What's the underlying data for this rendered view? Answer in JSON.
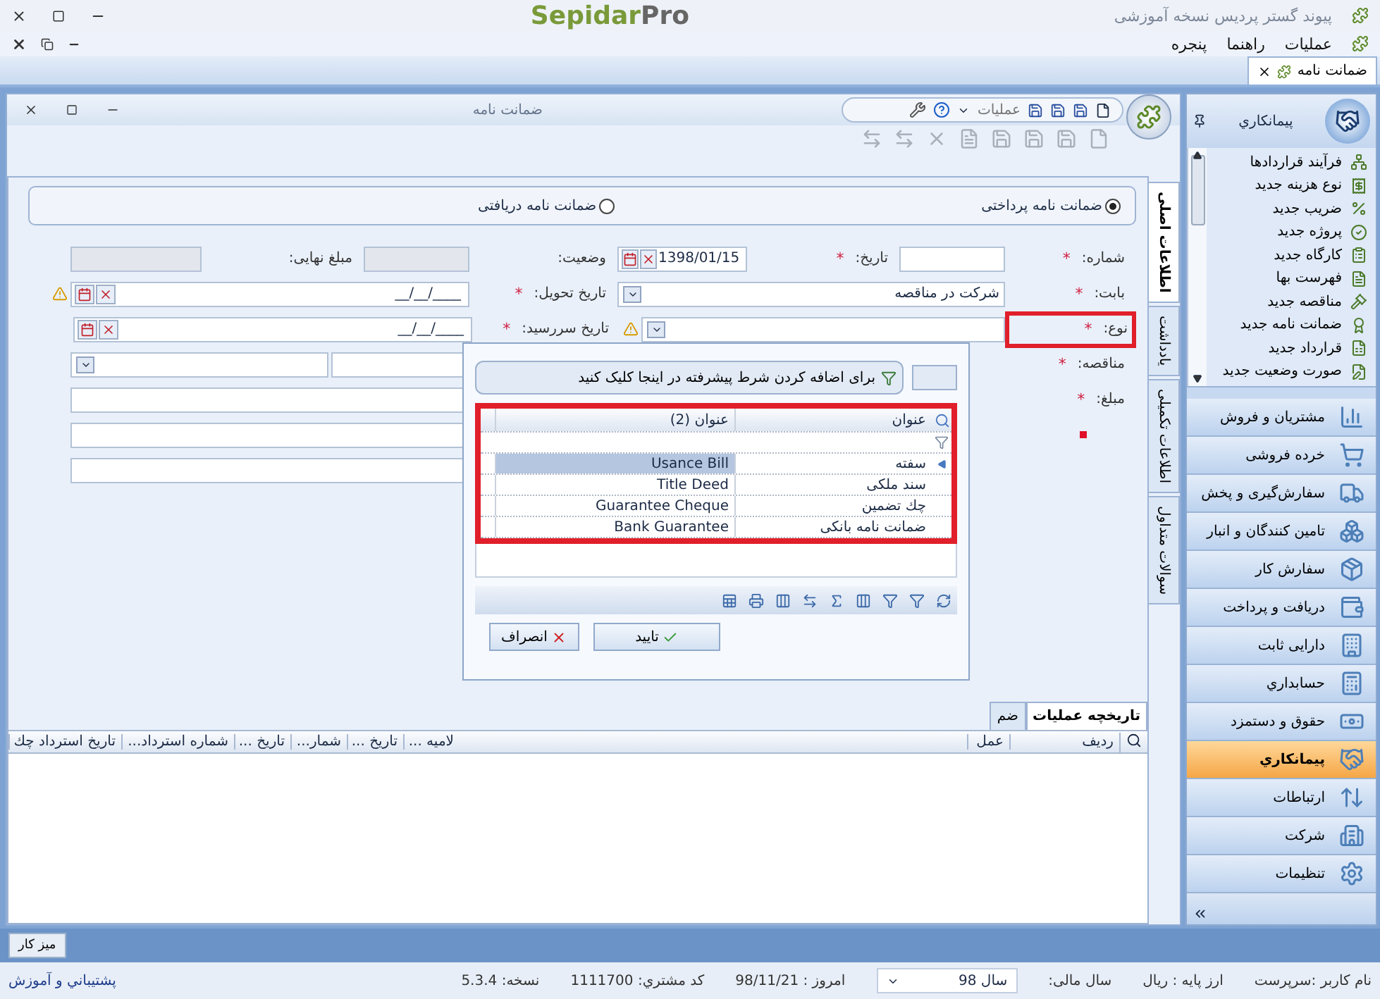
{
  "app": {
    "title": "پیوند گستر پردیس نسخه آموزشی",
    "logo_main": "Sepidar",
    "logo_accent": "Pro"
  },
  "menu": [
    "عملیات",
    "راهنما",
    "پنجره"
  ],
  "doc_tabs": [
    {
      "label": "ضمانت نامه",
      "selected": true
    }
  ],
  "form_window": {
    "title": "ضمانت نامه",
    "toolbar_menu": "عملیات"
  },
  "radio_options": [
    {
      "label": "ضمانت نامه پرداختی",
      "selected": true
    },
    {
      "label": "ضمانت نامه دریافتی",
      "selected": false
    }
  ],
  "required_symbol": "*",
  "form": {
    "number": {
      "label": "شماره:",
      "required": true
    },
    "date": {
      "label": "تاریخ:",
      "required": true,
      "value": "1398/01/15"
    },
    "status": {
      "label": "وضعیت:",
      "disabled": true
    },
    "final_amount": {
      "label": "مبلغ نهایی:",
      "disabled": true
    },
    "subject": {
      "label": "بابت:",
      "required": true,
      "value": "شرکت در مناقصه"
    },
    "delivery_date": {
      "label": "تاریخ تحویل:",
      "required": true,
      "value": "__/__/____",
      "warning": true
    },
    "type": {
      "label": "نوع:",
      "required": true,
      "highlighted": true,
      "warning": true
    },
    "due_date": {
      "label": "تاریخ سررسید:",
      "required": true,
      "value": "__/__/____"
    },
    "tender": {
      "label": "مناقصه:",
      "required": true
    },
    "amount": {
      "label": "مبلغ:",
      "required": true,
      "error": true
    }
  },
  "side_tabs": [
    {
      "label": "اطلاعات اصلی",
      "selected": true
    },
    {
      "label": "یادداشت",
      "selected": false
    },
    {
      "label": "اطلاعات تکمیلی",
      "selected": false
    },
    {
      "label": "سوالات متداول",
      "selected": false
    }
  ],
  "bottom_tabs": [
    {
      "label": "تاریخچه عملیات",
      "selected": true
    },
    {
      "label": "ضم",
      "selected": false
    }
  ],
  "grid_columns": {
    "right": [
      "ردیف",
      "عمل"
    ],
    "left": [
      "لامیه ...",
      "تاریخ ...",
      "شمار...",
      "تاریخ ...",
      "شماره استرداد...",
      "تاریخ استرداد چك"
    ]
  },
  "lookup": {
    "filter_button": "برای اضافه کردن شرط پیشرفته در اینجا کلیک کنید",
    "columns": [
      "عنوان",
      "عنوان (2)"
    ],
    "rows": [
      {
        "cells": [
          "سفته",
          "Usance Bill"
        ],
        "selected": true
      },
      {
        "cells": [
          "سند ملکی",
          "Title Deed"
        ],
        "selected": false
      },
      {
        "cells": [
          "چك تضمین",
          "Guarantee Cheque"
        ],
        "selected": false
      },
      {
        "cells": [
          "ضمانت نامه بانکی",
          "Bank Guarantee"
        ],
        "selected": false
      }
    ],
    "ok": "تایید",
    "cancel": "انصراف"
  },
  "sidebar": {
    "title": "پیمانكاري",
    "items": [
      "فرآیند قراردادها",
      "نوع هزینه جدید",
      "ضریب جدید",
      "پروژه جدید",
      "کارگاه جدید",
      "فهرست بها",
      "مناقصه جدید",
      "ضمانت نامه جدید",
      "قرارداد جدید",
      "صورت وضعیت جدید"
    ],
    "nav": [
      {
        "label": "مشتریان و فروش",
        "selected": false
      },
      {
        "label": "خرده فروشی",
        "selected": false
      },
      {
        "label": "سفارش‌گیری و پخش",
        "selected": false
      },
      {
        "label": "تامین کنندگان و انبار",
        "selected": false
      },
      {
        "label": "سفارش کار",
        "selected": false
      },
      {
        "label": "دریافت و پرداخت",
        "selected": false
      },
      {
        "label": "دارایی ثابت",
        "selected": false
      },
      {
        "label": "حسابداري",
        "selected": false
      },
      {
        "label": "حقوق و دستمزد",
        "selected": false
      },
      {
        "label": "پیمانكاري",
        "selected": true
      },
      {
        "label": "ارتباطات",
        "selected": false
      },
      {
        "label": "شرکت",
        "selected": false
      },
      {
        "label": "تنظیمات",
        "selected": false
      }
    ]
  },
  "workspace_tab": "میز کار",
  "status": {
    "user": "نام کاربر :سرپرست",
    "currency": "ارز پایه :  ریال",
    "fiscal_label": "سال مالی:",
    "fiscal_year": "سال 98",
    "today": "امروز :  98/11/21",
    "customer": "کد مشتري:  1111700",
    "version": "نسخه:  5.3.4",
    "support": "پشتیباني و آموزش"
  }
}
